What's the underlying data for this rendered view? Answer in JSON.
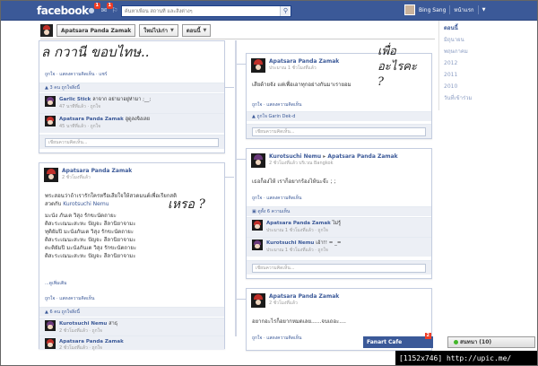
{
  "topbar": {
    "logo": "facebook",
    "notif_friends": "1",
    "notif_messages": "1",
    "search_placeholder": "ค้นหาเพื่อน สถานที่ และสิ่งต่างๆ",
    "user_name": "Bing Sang",
    "home_label": "หน้าแรก"
  },
  "subheader": {
    "profile_button": "Apatsara Panda Zamak",
    "filter_recent": "ใหม่ไปเก่า",
    "filter_now": "ตอนนี้"
  },
  "years": {
    "items": [
      "ตอนนี้",
      "มิถุนายน",
      "พฤษภาคม",
      "2012",
      "2011",
      "2010",
      "วันที่เข้าร่วม"
    ]
  },
  "cards": {
    "c1": {
      "handwriting": "ล กวานี ขอบไทษ..",
      "actions": "ถูกใจ · แสดงความคิดเห็น · แชร์",
      "likes": "3 คน ถูกใจสิ่งนี้",
      "comment1_name": "Garlic Stick",
      "comment1_text": "ลาจาก อย่ามาอยู่ห่ามา ;__;",
      "comment1_meta": "47 นาทีที่แล้ว · ถูกใจ",
      "comment2_name": "Apatsara Panda Zamak",
      "comment2_text": "ฮูดูลงจิงเลย",
      "comment2_meta": "45 นาทีที่แล้ว · ถูกใจ",
      "write_placeholder": "เขียนความคิดเห็น..."
    },
    "c2": {
      "author": "Apatsara Panda Zamak",
      "meta": "ประมาณ 1 ชั่วโมงที่แล้ว",
      "text": "เสียด้ายจัง แต่เพื่อเอาทุกอย่างกันมาเรายอม",
      "actions": "ถูกใจ · แสดงความคิดเห็น",
      "like_line": "ถูกใจ Garin Dek-d",
      "write_placeholder": "เขียนความคิดเห็น...",
      "handwriting": "เพื่ออะไรคะ ?"
    },
    "c3": {
      "author": "Apatsara Panda Zamak",
      "meta": "2 ชั่วโมงที่แล้ว",
      "line1": "พระสอนว่าถ้าเรารักใครหรือเสียใจให้สวดมนต์เพื่อเรียกสติ",
      "line2_prefix": "สวดกับ ",
      "line2_link": "Kurotsuchi Nemu",
      "chant1": "มะนัง ภันเต วิสุง รักขะนัตถายะ",
      "chant2": "ติสะระเณนะสะหะ ปัญจะ สีลานิยาจามะ",
      "chant3": "ทุติยัมปิ มะนังภันเต วิสุง รักขะนัตถายะ",
      "chant4": "ติสะระเณนะสะหะ ปัญจะ สีลานิยาจามะ",
      "chant5": "ตะติยัมปิ มะนังภันเต วิสุง รักขะนัตถายะ",
      "chant6": "ติสะระเณนะสะหะ ปัญจะ สีลานิยาจามะ",
      "see_more": "...ดูเพิ่มเติม",
      "actions": "ถูกใจ · แสดงความคิดเห็น",
      "likes": "6 คน ถูกใจสิ่งนี้",
      "comment1_name": "Kurotsuchi Nemu",
      "comment1_text": "สาธุ",
      "comment1_meta": "2 ชั่วโมงที่แล้ว · ถูกใจ",
      "comment2_name": "Apatsara Panda Zamak",
      "comment2_meta": "2 ชั่วโมงที่แล้ว · ถูกใจ",
      "handwriting": "เหรอ ?"
    },
    "c4": {
      "author": "Kurotsuchi Nemu",
      "arrow": "▸",
      "target": "Apatsara Panda Zamak",
      "meta": "2 ชั่วโมงที่แล้ว บริเวณ Bangkok",
      "text": "เธอก็อง่ไห้ เราก็อยากร้องไห้นะจ๊ะ ; ;",
      "actions": "ถูกใจ · แสดงความคิดเห็น",
      "replies": "ดูทั้ง 6 ความเห็น",
      "comment1_name": "Apatsara Panda Zamak",
      "comment1_text": "ไม่รู้",
      "comment1_meta": "ประมาณ 1 ชั่วโมงที่แล้ว · ถูกใจ",
      "comment2_name": "Kurotsuchi Nemu",
      "comment2_text": "เอ้า!! = _=",
      "comment2_meta": "ประมาณ 1 ชั่วโมงที่แล้ว · ถูกใจ",
      "write_placeholder": "เขียนความคิดเห็น..."
    },
    "c5": {
      "author": "Apatsara Panda Zamak",
      "meta": "2 ชั่วโมงที่แล้ว",
      "text": "อยากอะไรก็อยากหมดเลย......จบเถอะ....",
      "actions": "ถูกใจ · แสดงความคิดเห็น"
    }
  },
  "chat": {
    "fanart_label": "Fanart Cafe",
    "fanart_badge": "2",
    "chat_label": "สนทนา (10)"
  },
  "caption": "[1152x746] http://upic.me/"
}
